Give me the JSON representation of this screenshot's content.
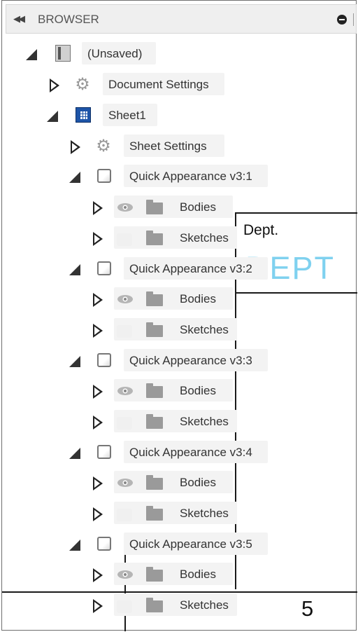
{
  "header": {
    "title": "BROWSER"
  },
  "icons": {
    "collapse": "double-left-arrow-icon",
    "minus": "minus-circle-icon",
    "gear": "gear-icon",
    "box": "component-box-icon",
    "folder": "folder-icon",
    "eye": "eye-icon"
  },
  "tree": {
    "root": "(Unsaved)",
    "document_settings": "Document Settings",
    "sheet": "Sheet1",
    "sheet_settings": "Sheet Settings",
    "components": [
      {
        "name": "Quick Appearance v3:1",
        "bodies": "Bodies",
        "sketches": "Sketches"
      },
      {
        "name": "Quick Appearance v3:2",
        "bodies": "Bodies",
        "sketches": "Sketches"
      },
      {
        "name": "Quick Appearance v3:3",
        "bodies": "Bodies",
        "sketches": "Sketches"
      },
      {
        "name": "Quick Appearance v3:4",
        "bodies": "Bodies",
        "sketches": "Sketches"
      },
      {
        "name": "Quick Appearance v3:5",
        "bodies": "Bodies",
        "sketches": "Sketches"
      }
    ]
  },
  "drawing": {
    "dept_label": "Dept.",
    "dept_big": "DEPT",
    "page_number": "5"
  }
}
